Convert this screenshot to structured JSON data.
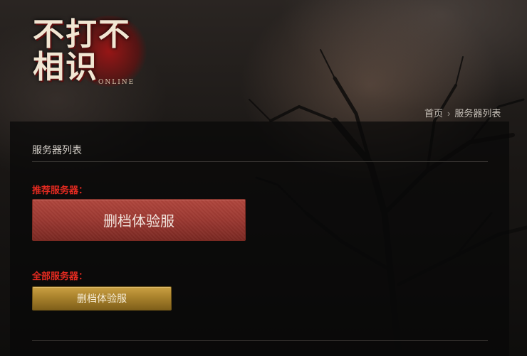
{
  "logo": {
    "title": "不打不相识",
    "subtitle": "ONLINE",
    "icon": "game-logo-icon"
  },
  "breadcrumb": {
    "home": "首页",
    "separator": "›",
    "current": "服务器列表"
  },
  "panel": {
    "title": "服务器列表",
    "recommended": {
      "label": "推荐服务器：",
      "server_name": "删档体验服"
    },
    "all": {
      "label": "全部服务器：",
      "servers": [
        "删档体验服"
      ]
    }
  },
  "colors": {
    "section_label": "#e12a20",
    "recommended_button": "#9b3831",
    "server_button": "#a9822c",
    "panel_bg": "#080808"
  }
}
